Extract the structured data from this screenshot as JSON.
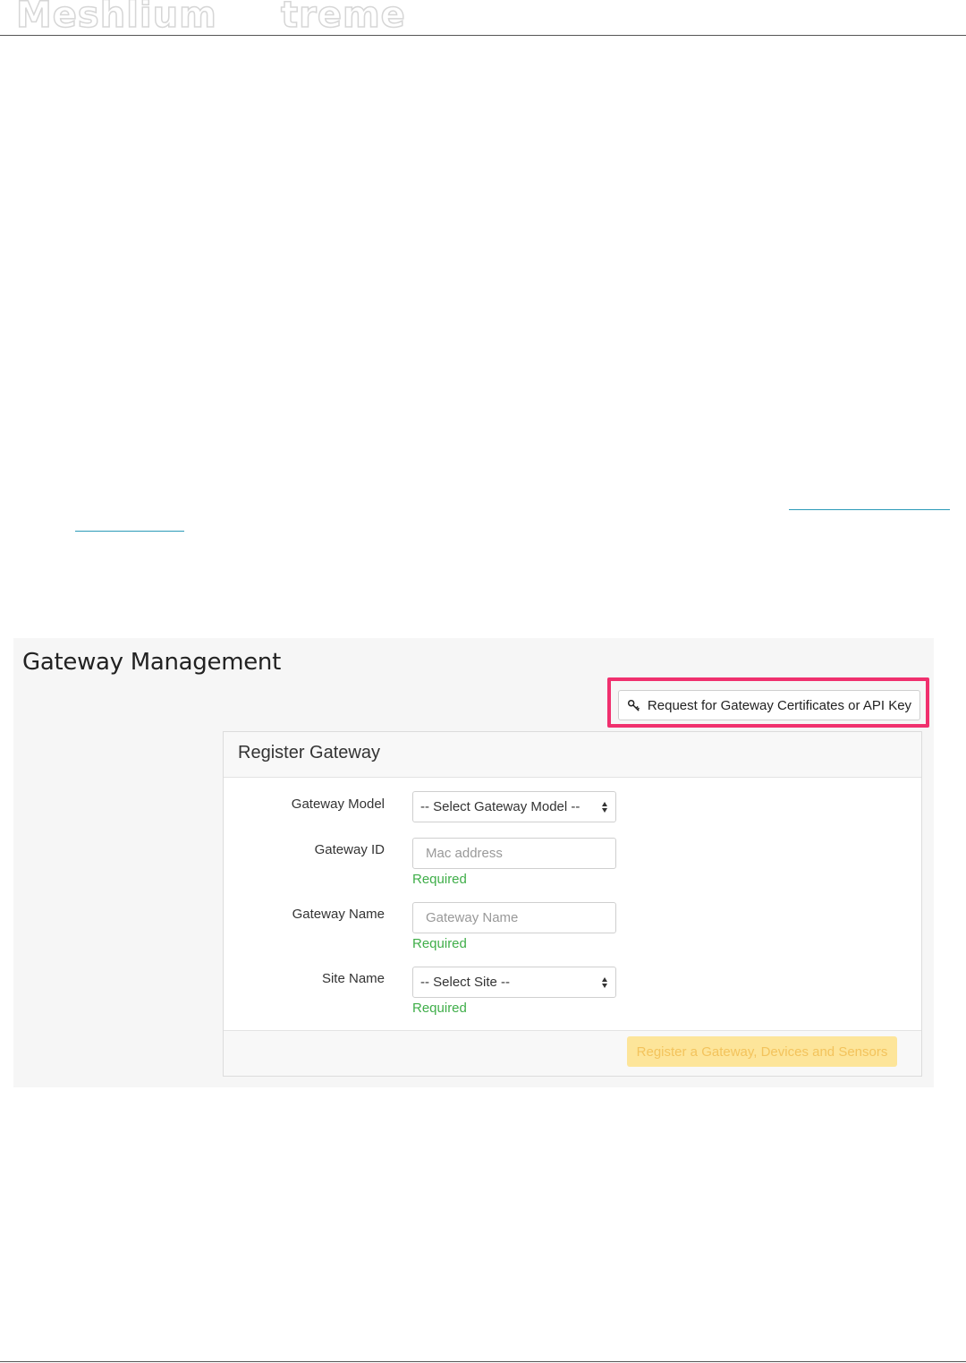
{
  "header": {
    "logo_word_1": "Meshlium",
    "logo_word_2": "treme"
  },
  "screenshot": {
    "title": "Gateway Management",
    "request_button_label": "Request for Gateway Certificates or API Key",
    "request_button_icon": "key-icon",
    "panel": {
      "title": "Register Gateway",
      "fields": {
        "gateway_model": {
          "label": "Gateway Model",
          "selected": "-- Select Gateway Model --"
        },
        "gateway_id": {
          "label": "Gateway ID",
          "placeholder": "Mac address",
          "help": "Required"
        },
        "gateway_name": {
          "label": "Gateway Name",
          "placeholder": "Gateway Name",
          "help": "Required"
        },
        "site_name": {
          "label": "Site Name",
          "selected": "-- Select Site --",
          "help": "Required"
        }
      },
      "submit_label": "Register a Gateway, Devices and Sensors"
    }
  },
  "colors": {
    "highlight": "#f0306e",
    "required": "#3fae49",
    "submit_bg": "#fde59a",
    "link": "#2b9bb8"
  }
}
